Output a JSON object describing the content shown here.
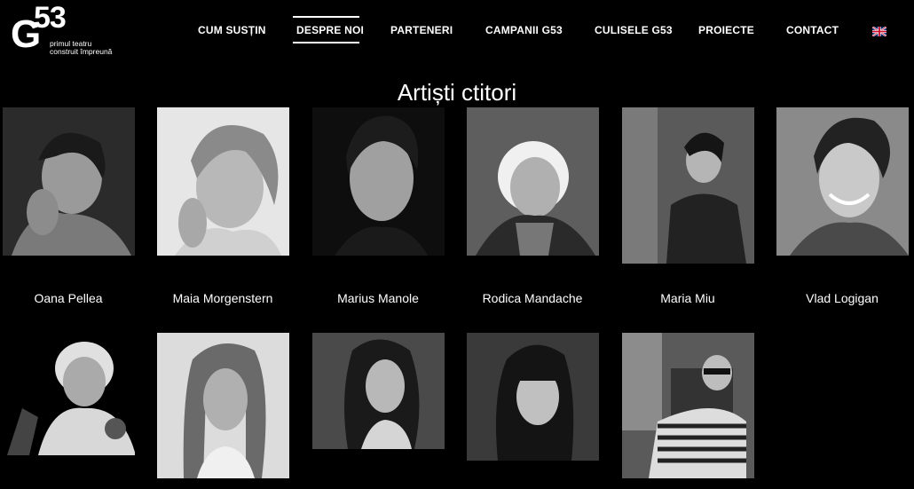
{
  "logo": {
    "letter": "G",
    "number": "53",
    "tagline_1": "primul teatru",
    "tagline_2": "construit împreună"
  },
  "nav": {
    "items": [
      "CUM SUSȚIN",
      "DESPRE NOI",
      "PARTENERI",
      "CAMPANII G53",
      "CULISELE G53",
      "PROIECTE",
      "CONTACT"
    ],
    "active": "DESPRE NOI",
    "language_icon": "uk-flag-icon"
  },
  "page": {
    "title": "Artiști ctitori"
  },
  "artists": [
    {
      "name": "Oana Pellea"
    },
    {
      "name": "Maia Morgenstern"
    },
    {
      "name": "Marius Manole"
    },
    {
      "name": "Rodica Mandache"
    },
    {
      "name": "Maria Miu"
    },
    {
      "name": "Vlad Logigan"
    },
    {
      "name": ""
    },
    {
      "name": ""
    },
    {
      "name": ""
    },
    {
      "name": ""
    },
    {
      "name": ""
    }
  ],
  "colors": {
    "background": "#000000",
    "text": "#ffffff"
  }
}
